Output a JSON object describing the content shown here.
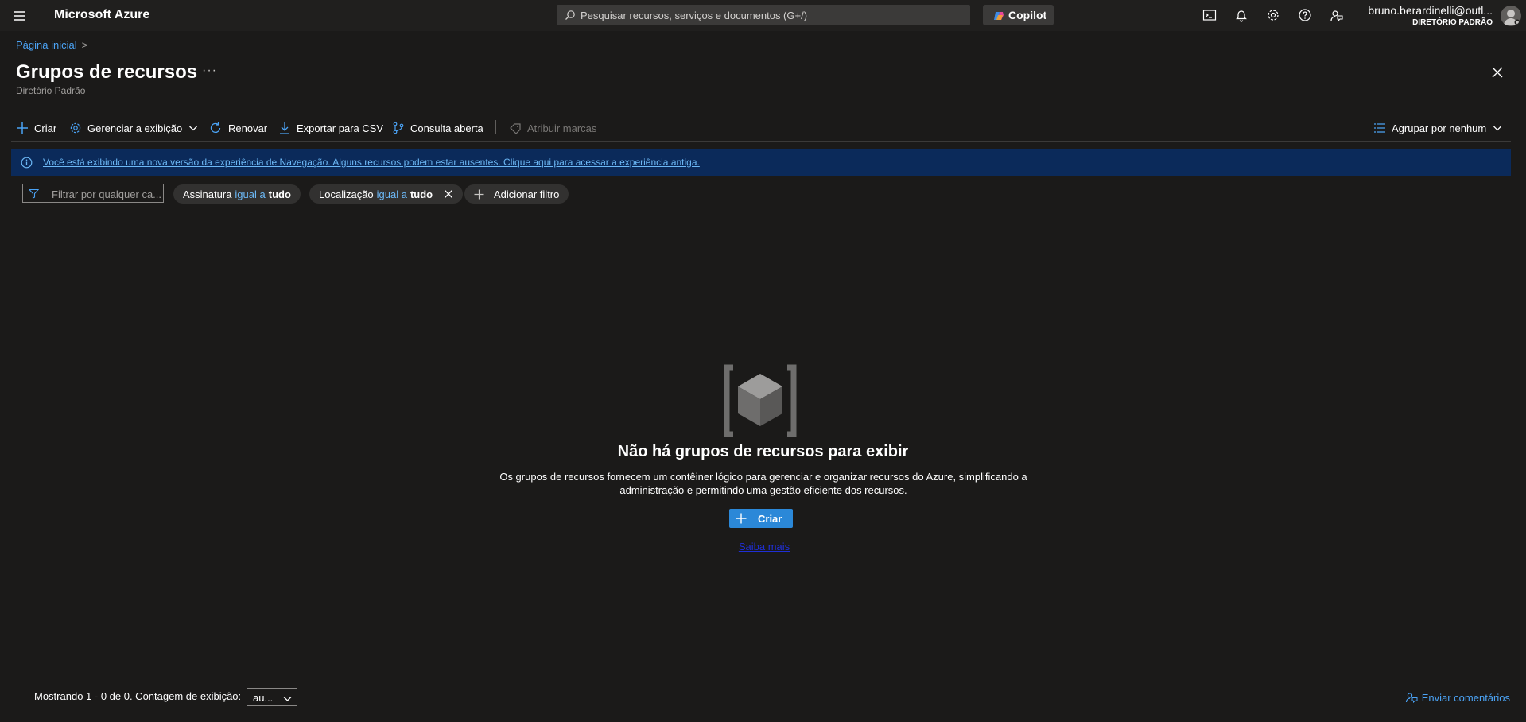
{
  "topbar": {
    "brand": "Microsoft Azure",
    "search_placeholder": "Pesquisar recursos, serviços e documentos (G+/)",
    "copilot_label": "Copilot",
    "user_email": "bruno.berardinelli@outl...",
    "user_directory": "DIRETÓRIO PADRÃO",
    "icons": [
      "cloud-shell-icon",
      "notifications-icon",
      "settings-icon",
      "help-icon",
      "feedback-icon"
    ]
  },
  "header": {
    "breadcrumb_home": "Página inicial",
    "breadcrumb_separator": ">",
    "title": "Grupos de recursos",
    "more_label": "···",
    "subtitle": "Diretório Padrão"
  },
  "commands": {
    "create": "Criar",
    "manage_view": "Gerenciar a exibição",
    "refresh": "Renovar",
    "export_csv": "Exportar para CSV",
    "open_query": "Consulta aberta",
    "assign_tags": "Atribuir marcas",
    "group_by": "Agrupar por nenhum"
  },
  "banner": {
    "text": "Você está exibindo uma nova versão da experiência de Navegação. Alguns recursos podem estar ausentes. Clique aqui para acessar a experiência antiga."
  },
  "filters": {
    "search_placeholder": "Filtrar por qualquer ca...",
    "subscription": {
      "field": "Assinatura",
      "operator": "igual a",
      "value": "tudo"
    },
    "location": {
      "field": "Localização",
      "operator": "igual a",
      "value": "tudo"
    },
    "add_filter": "Adicionar filtro"
  },
  "empty_state": {
    "title": "Não há grupos de recursos para exibir",
    "description": "Os grupos de recursos fornecem um contêiner lógico para gerenciar e organizar recursos do Azure, simplificando a administração e permitindo uma gestão eficiente dos recursos.",
    "create_label": "Criar",
    "learn_more": "Saiba mais"
  },
  "footer": {
    "showing": "Mostrando 1 - 0 de 0. Contagem de exibição:",
    "count_value": "au...",
    "feedback": "Enviar comentários"
  },
  "colors": {
    "background": "#1b1a19",
    "topbar": "#201f1e",
    "accent": "#2b88d8",
    "link": "#4ba3f5",
    "banner": "#0b2a5a"
  }
}
